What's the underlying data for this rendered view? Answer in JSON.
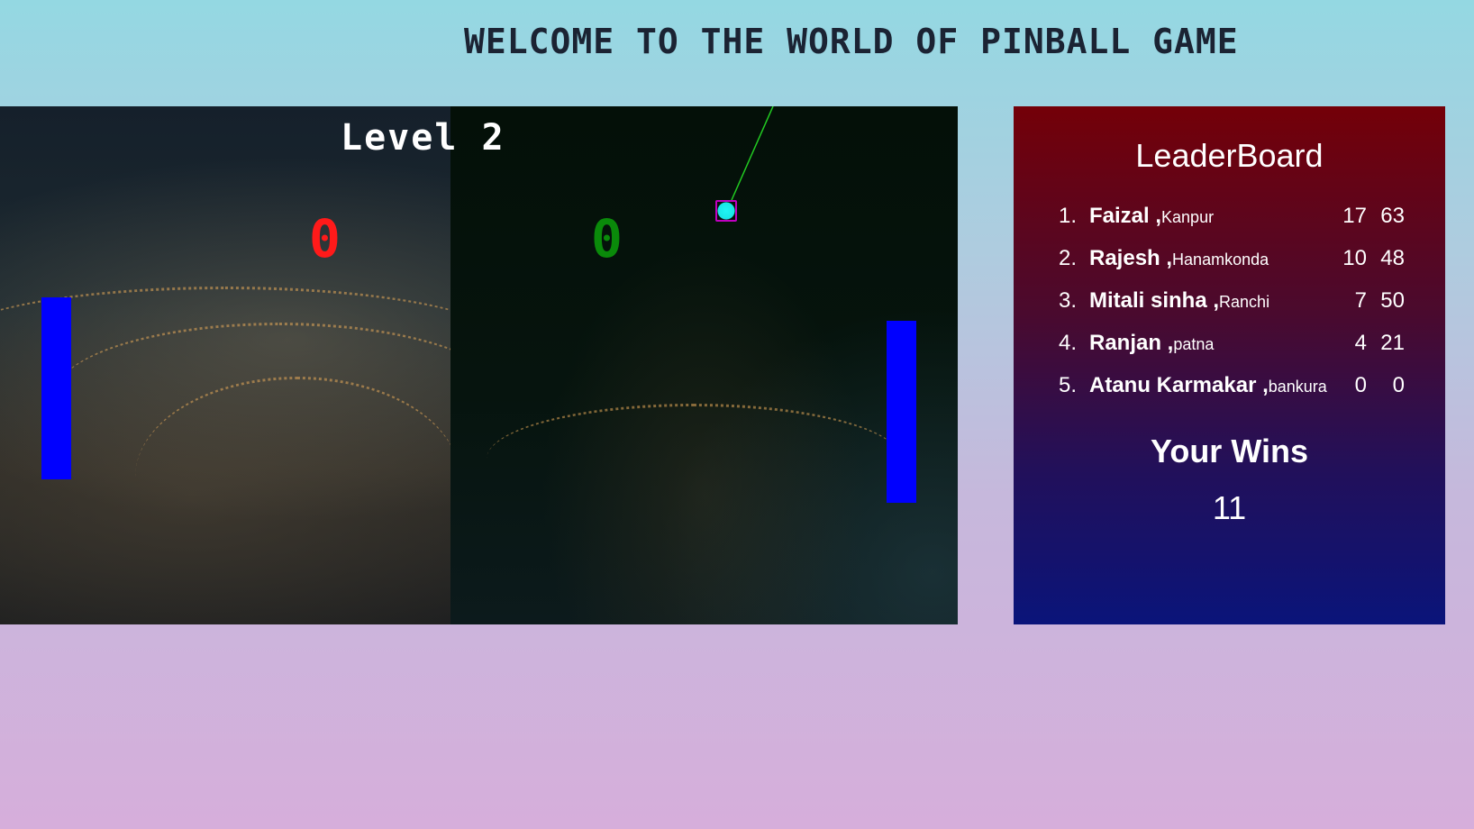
{
  "header": {
    "title": "WELCOME TO THE WORLD OF PINBALL GAME"
  },
  "game": {
    "level_label": "Level 2",
    "score_left": "0",
    "score_right": "0",
    "colors": {
      "paddle": "#0000ff",
      "ball": "#1ff4f4",
      "score_left": "#ff1a1a",
      "score_right": "#0a8a0a",
      "trail": "#22cc22"
    }
  },
  "leaderboard": {
    "title": "LeaderBoard",
    "entries": [
      {
        "rank": "1.",
        "name": "Faizal ,",
        "city": "Kanpur",
        "wins": "17",
        "points": "63"
      },
      {
        "rank": "2.",
        "name": "Rajesh ,",
        "city": "Hanamkonda",
        "wins": "10",
        "points": "48"
      },
      {
        "rank": "3.",
        "name": "Mitali sinha ,",
        "city": "Ranchi",
        "wins": "7",
        "points": "50"
      },
      {
        "rank": "4.",
        "name": "Ranjan ,",
        "city": "patna",
        "wins": "4",
        "points": "21"
      },
      {
        "rank": "5.",
        "name": "Atanu Karmakar ,",
        "city": "bankura",
        "wins": "0",
        "points": "0"
      }
    ],
    "your_wins_label": "Your Wins",
    "your_wins_value": "11"
  }
}
